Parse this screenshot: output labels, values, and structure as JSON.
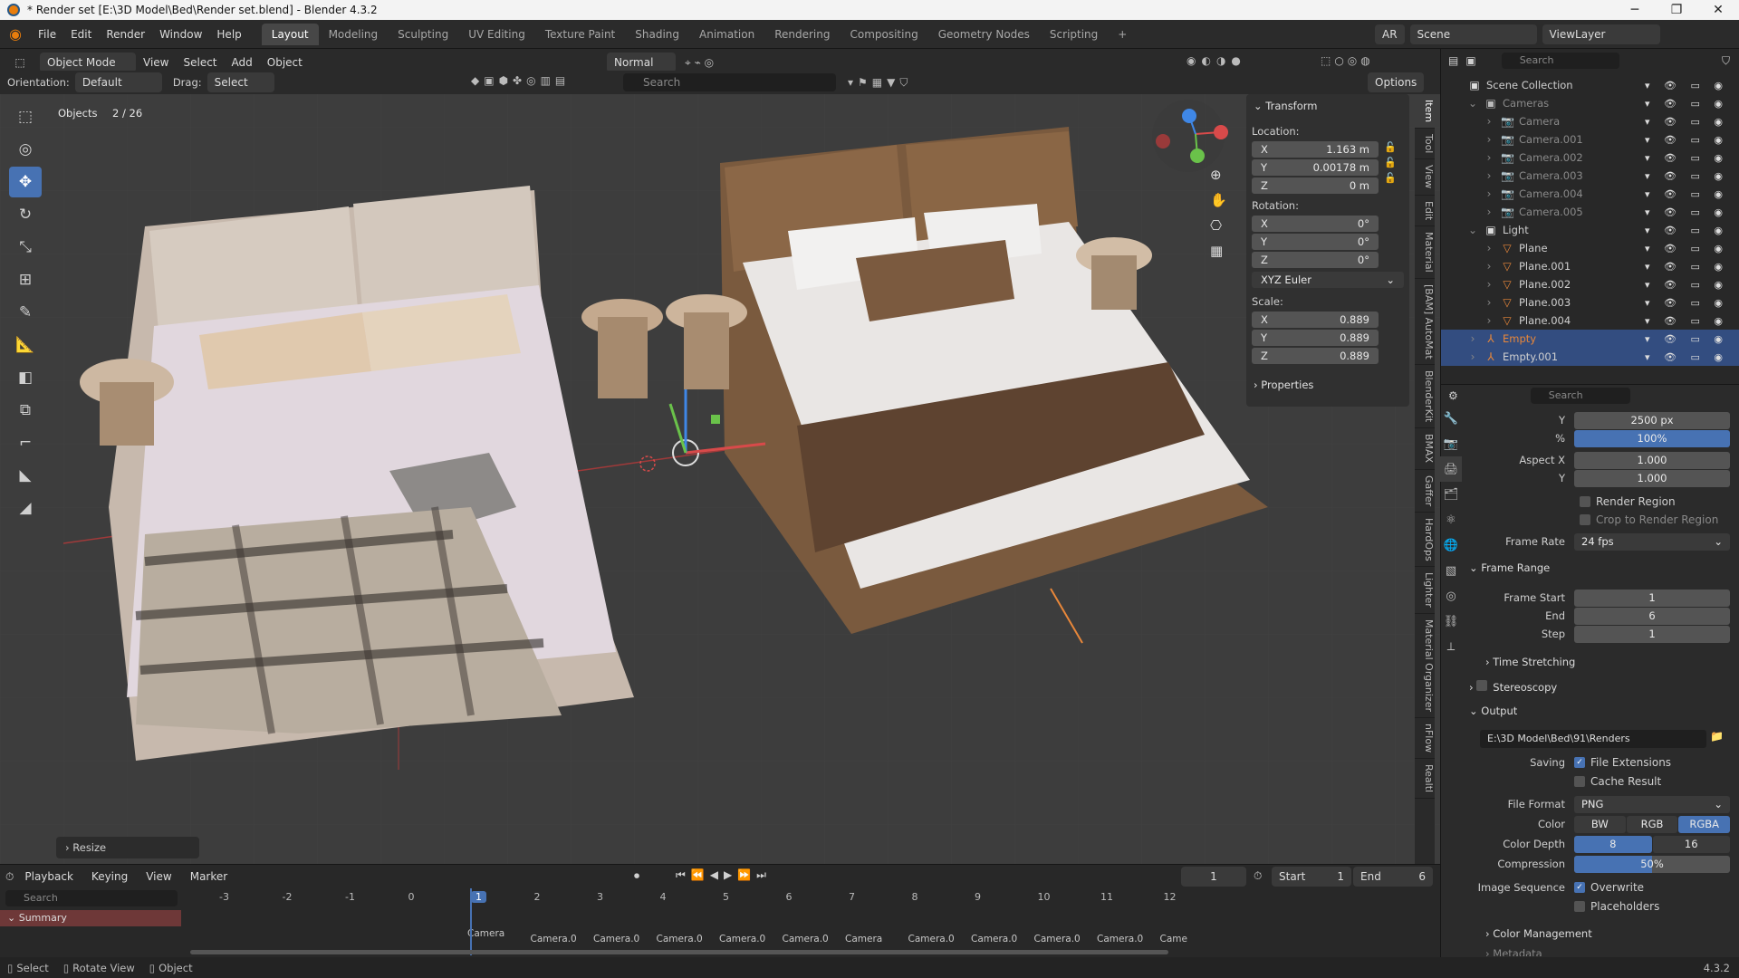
{
  "window": {
    "title": "* Render set [E:\\3D Model\\Bed\\Render set.blend] - Blender 4.3.2"
  },
  "menu": [
    "File",
    "Edit",
    "Render",
    "Window",
    "Help"
  ],
  "workspaces": [
    "Layout",
    "Modeling",
    "Sculpting",
    "UV Editing",
    "Texture Paint",
    "Shading",
    "Animation",
    "Rendering",
    "Compositing",
    "Geometry Nodes",
    "Scripting"
  ],
  "active_workspace": "Layout",
  "top_right": {
    "scene": "Scene",
    "viewlayer": "ViewLayer",
    "engine": "AR"
  },
  "viewport_header": {
    "mode": "Object Mode",
    "view": "View",
    "select": "Select",
    "add": "Add",
    "object": "Object",
    "orientation_label": "Orientation:",
    "orientation_value": "Default",
    "drag_label": "Drag:",
    "drag_value": "Select Box",
    "pivot": "Normal",
    "search_placeholder": "Search",
    "options": "Options"
  },
  "viewport": {
    "objects_label": "Objects",
    "objects_count": "2 / 26",
    "last_op": "Resize"
  },
  "transform": {
    "title": "Transform",
    "location_label": "Location:",
    "loc_x": "1.163 m",
    "loc_y": "0.00178 m",
    "loc_z": "0 m",
    "rotation_label": "Rotation:",
    "rot_x": "0°",
    "rot_y": "0°",
    "rot_z": "0°",
    "rotation_mode": "XYZ Euler",
    "scale_label": "Scale:",
    "scale_x": "0.889",
    "scale_y": "0.889",
    "scale_z": "0.889",
    "properties": "Properties",
    "axis_x": "X",
    "axis_y": "Y",
    "axis_z": "Z"
  },
  "n_tabs": [
    "Item",
    "Tool",
    "View",
    "Edit",
    "Material",
    "[BAM] AutoMat",
    "BlenderKit",
    "BMAX",
    "Gaffer",
    "HardOps",
    "Lighter",
    "Material Organizer",
    "nFlow",
    "Realtl"
  ],
  "outliner": {
    "search_placeholder": "Search",
    "root": "Scene Collection",
    "cameras_collection": "Cameras",
    "cameras": [
      "Camera",
      "Camera.001",
      "Camera.002",
      "Camera.003",
      "Camera.004",
      "Camera.005"
    ],
    "light_collection": "Light",
    "planes": [
      "Plane",
      "Plane.001",
      "Plane.002",
      "Plane.003",
      "Plane.004"
    ],
    "empties": [
      "Empty",
      "Empty.001"
    ]
  },
  "properties": {
    "search_placeholder": "Search",
    "res_y_label": "Y",
    "res_y": "2500 px",
    "pct_label": "%",
    "pct": "100%",
    "aspect_x_label": "Aspect X",
    "aspect_x": "1.000",
    "aspect_y_label": "Y",
    "aspect_y": "1.000",
    "render_region": "Render Region",
    "crop": "Crop to Render Region",
    "frame_rate_label": "Frame Rate",
    "frame_rate": "24 fps",
    "frame_range": "Frame Range",
    "frame_start_label": "Frame Start",
    "frame_start": "1",
    "end_label": "End",
    "end": "6",
    "step_label": "Step",
    "step": "1",
    "time_stretching": "Time Stretching",
    "stereoscopy": "Stereoscopy",
    "output": "Output",
    "output_path": "E:\\3D Model\\Bed\\91\\Renders",
    "saving_label": "Saving",
    "file_extensions": "File Extensions",
    "cache_result": "Cache Result",
    "file_format_label": "File Format",
    "file_format": "PNG",
    "color_label": "Color",
    "color_opts": [
      "BW",
      "RGB",
      "RGBA"
    ],
    "color_active": "RGBA",
    "depth_label": "Color Depth",
    "depth_opts": [
      "8",
      "16"
    ],
    "compression_label": "Compression",
    "compression": "50%",
    "compression_fraction": 0.5,
    "image_seq_label": "Image Sequence",
    "overwrite": "Overwrite",
    "placeholders": "Placeholders",
    "color_management": "Color Management",
    "metadata": "Metadata"
  },
  "timeline": {
    "menus": [
      "Playback",
      "Keying",
      "View",
      "Marker"
    ],
    "current_frame": "1",
    "start_label": "Start",
    "start": "1",
    "end_label": "End",
    "end": "6",
    "search_placeholder": "Search",
    "summary": "Summary",
    "ticks": [
      "-3",
      "-2",
      "-1",
      "0",
      "1",
      "2",
      "3",
      "4",
      "5",
      "6",
      "7",
      "8",
      "9",
      "10",
      "11",
      "12"
    ],
    "markers": [
      "Camera",
      "Camera.0",
      "Camera.0",
      "Camera.0",
      "Camera.0",
      "Camera.0",
      "Camera",
      "Camera.0",
      "Camera.0",
      "Camera.0",
      "Camera.0",
      "Came"
    ]
  },
  "statusbar": {
    "select": "Select",
    "rotate": "Rotate View",
    "object": "Object",
    "version": "4.3.2"
  },
  "colors": {
    "accent": "#4772b3",
    "selected_row": "#334d80",
    "active_empty": "#e8873a",
    "bg": "#3d3d3d"
  }
}
